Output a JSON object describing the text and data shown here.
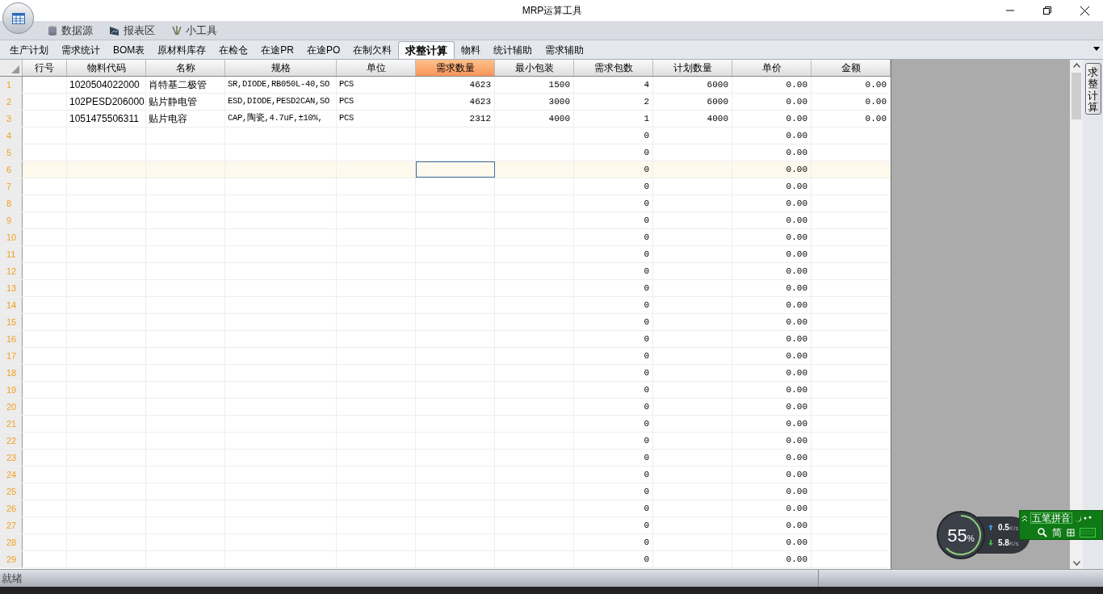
{
  "window": {
    "title": "MRP运算工具"
  },
  "ribbon_tabs": [
    {
      "label": "数据源",
      "kind": "database"
    },
    {
      "label": "报表区",
      "kind": "report"
    },
    {
      "label": "小工具",
      "kind": "tools"
    }
  ],
  "tabs": [
    {
      "label": "生产计划",
      "selected": false
    },
    {
      "label": "需求统计",
      "selected": false
    },
    {
      "label": "BOM表",
      "selected": false
    },
    {
      "label": "原材料库存",
      "selected": false
    },
    {
      "label": "在检仓",
      "selected": false
    },
    {
      "label": "在途PR",
      "selected": false
    },
    {
      "label": "在途PO",
      "selected": false
    },
    {
      "label": "在制欠料",
      "selected": false
    },
    {
      "label": "求整计算",
      "selected": true
    },
    {
      "label": "物料",
      "selected": false
    },
    {
      "label": "统计辅助",
      "selected": false
    },
    {
      "label": "需求辅助",
      "selected": false
    }
  ],
  "table": {
    "columns": [
      {
        "label": "行号",
        "kind": "text",
        "selected": false
      },
      {
        "label": "物料代码",
        "kind": "text",
        "selected": false
      },
      {
        "label": "名称",
        "kind": "text",
        "selected": false
      },
      {
        "label": "规格",
        "kind": "code",
        "selected": false
      },
      {
        "label": "单位",
        "kind": "code",
        "selected": false
      },
      {
        "label": "需求数量",
        "kind": "number",
        "selected": true
      },
      {
        "label": "最小包装",
        "kind": "number",
        "selected": false
      },
      {
        "label": "需求包数",
        "kind": "number",
        "selected": false
      },
      {
        "label": "计划数量",
        "kind": "number",
        "selected": false
      },
      {
        "label": "单价",
        "kind": "number",
        "selected": false
      },
      {
        "label": "金额",
        "kind": "number",
        "selected": false
      }
    ],
    "rows": [
      {
        "num": "1",
        "selected": false,
        "cells": [
          "",
          "1020504022000",
          "肖特基二极管",
          "SR,DIODE,RB050L-40,SO",
          "PCS",
          "4623",
          "1500",
          "4",
          "6000",
          "0.00",
          "0.00"
        ]
      },
      {
        "num": "2",
        "selected": false,
        "cells": [
          "",
          "102PESD206000",
          "贴片静电管",
          "ESD,DIODE,PESD2CAN,SO",
          "PCS",
          "4623",
          "3000",
          "2",
          "6000",
          "0.00",
          "0.00"
        ]
      },
      {
        "num": "3",
        "selected": false,
        "cells": [
          "",
          "1051475506311",
          "贴片电容",
          "CAP,陶瓷,4.7uF,±10%,",
          "PCS",
          "2312",
          "4000",
          "1",
          "4000",
          "0.00",
          "0.00"
        ]
      },
      {
        "num": "4",
        "selected": false,
        "cells": [
          "",
          "",
          "",
          "",
          "",
          "",
          "",
          "0",
          "",
          "0.00",
          ""
        ]
      },
      {
        "num": "5",
        "selected": false,
        "cells": [
          "",
          "",
          "",
          "",
          "",
          "",
          "",
          "0",
          "",
          "0.00",
          ""
        ]
      },
      {
        "num": "6",
        "selected": true,
        "cells": [
          "",
          "",
          "",
          "",
          "",
          "",
          "",
          "0",
          "",
          "0.00",
          ""
        ]
      },
      {
        "num": "7",
        "selected": false,
        "cells": [
          "",
          "",
          "",
          "",
          "",
          "",
          "",
          "0",
          "",
          "0.00",
          ""
        ]
      },
      {
        "num": "8",
        "selected": false,
        "cells": [
          "",
          "",
          "",
          "",
          "",
          "",
          "",
          "0",
          "",
          "0.00",
          ""
        ]
      },
      {
        "num": "9",
        "selected": false,
        "cells": [
          "",
          "",
          "",
          "",
          "",
          "",
          "",
          "0",
          "",
          "0.00",
          ""
        ]
      },
      {
        "num": "10",
        "selected": false,
        "cells": [
          "",
          "",
          "",
          "",
          "",
          "",
          "",
          "0",
          "",
          "0.00",
          ""
        ]
      },
      {
        "num": "11",
        "selected": false,
        "cells": [
          "",
          "",
          "",
          "",
          "",
          "",
          "",
          "0",
          "",
          "0.00",
          ""
        ]
      },
      {
        "num": "12",
        "selected": false,
        "cells": [
          "",
          "",
          "",
          "",
          "",
          "",
          "",
          "0",
          "",
          "0.00",
          ""
        ]
      },
      {
        "num": "13",
        "selected": false,
        "cells": [
          "",
          "",
          "",
          "",
          "",
          "",
          "",
          "0",
          "",
          "0.00",
          ""
        ]
      },
      {
        "num": "14",
        "selected": false,
        "cells": [
          "",
          "",
          "",
          "",
          "",
          "",
          "",
          "0",
          "",
          "0.00",
          ""
        ]
      },
      {
        "num": "15",
        "selected": false,
        "cells": [
          "",
          "",
          "",
          "",
          "",
          "",
          "",
          "0",
          "",
          "0.00",
          ""
        ]
      },
      {
        "num": "16",
        "selected": false,
        "cells": [
          "",
          "",
          "",
          "",
          "",
          "",
          "",
          "0",
          "",
          "0.00",
          ""
        ]
      },
      {
        "num": "17",
        "selected": false,
        "cells": [
          "",
          "",
          "",
          "",
          "",
          "",
          "",
          "0",
          "",
          "0.00",
          ""
        ]
      },
      {
        "num": "18",
        "selected": false,
        "cells": [
          "",
          "",
          "",
          "",
          "",
          "",
          "",
          "0",
          "",
          "0.00",
          ""
        ]
      },
      {
        "num": "19",
        "selected": false,
        "cells": [
          "",
          "",
          "",
          "",
          "",
          "",
          "",
          "0",
          "",
          "0.00",
          ""
        ]
      },
      {
        "num": "20",
        "selected": false,
        "cells": [
          "",
          "",
          "",
          "",
          "",
          "",
          "",
          "0",
          "",
          "0.00",
          ""
        ]
      },
      {
        "num": "21",
        "selected": false,
        "cells": [
          "",
          "",
          "",
          "",
          "",
          "",
          "",
          "0",
          "",
          "0.00",
          ""
        ]
      },
      {
        "num": "22",
        "selected": false,
        "cells": [
          "",
          "",
          "",
          "",
          "",
          "",
          "",
          "0",
          "",
          "0.00",
          ""
        ]
      },
      {
        "num": "23",
        "selected": false,
        "cells": [
          "",
          "",
          "",
          "",
          "",
          "",
          "",
          "0",
          "",
          "0.00",
          ""
        ]
      },
      {
        "num": "24",
        "selected": false,
        "cells": [
          "",
          "",
          "",
          "",
          "",
          "",
          "",
          "0",
          "",
          "0.00",
          ""
        ]
      },
      {
        "num": "25",
        "selected": false,
        "cells": [
          "",
          "",
          "",
          "",
          "",
          "",
          "",
          "0",
          "",
          "0.00",
          ""
        ]
      },
      {
        "num": "26",
        "selected": false,
        "cells": [
          "",
          "",
          "",
          "",
          "",
          "",
          "",
          "0",
          "",
          "0.00",
          ""
        ]
      },
      {
        "num": "27",
        "selected": false,
        "cells": [
          "",
          "",
          "",
          "",
          "",
          "",
          "",
          "0",
          "",
          "0.00",
          ""
        ]
      },
      {
        "num": "28",
        "selected": false,
        "cells": [
          "",
          "",
          "",
          "",
          "",
          "",
          "",
          "0",
          "",
          "0.00",
          ""
        ]
      },
      {
        "num": "29",
        "selected": false,
        "cells": [
          "",
          "",
          "",
          "",
          "",
          "",
          "",
          "0",
          "",
          "0.00",
          ""
        ]
      }
    ]
  },
  "side_tab": {
    "label": "求整计算"
  },
  "status_bar": {
    "text": "就绪"
  },
  "net_widget": {
    "percent": "55",
    "unit": "%",
    "upload": "0.5",
    "upload_unit": "K/s",
    "download": "5.8",
    "download_unit": "K/s"
  },
  "ime_bar": {
    "mode": "五笔拼音",
    "charset": "简"
  }
}
